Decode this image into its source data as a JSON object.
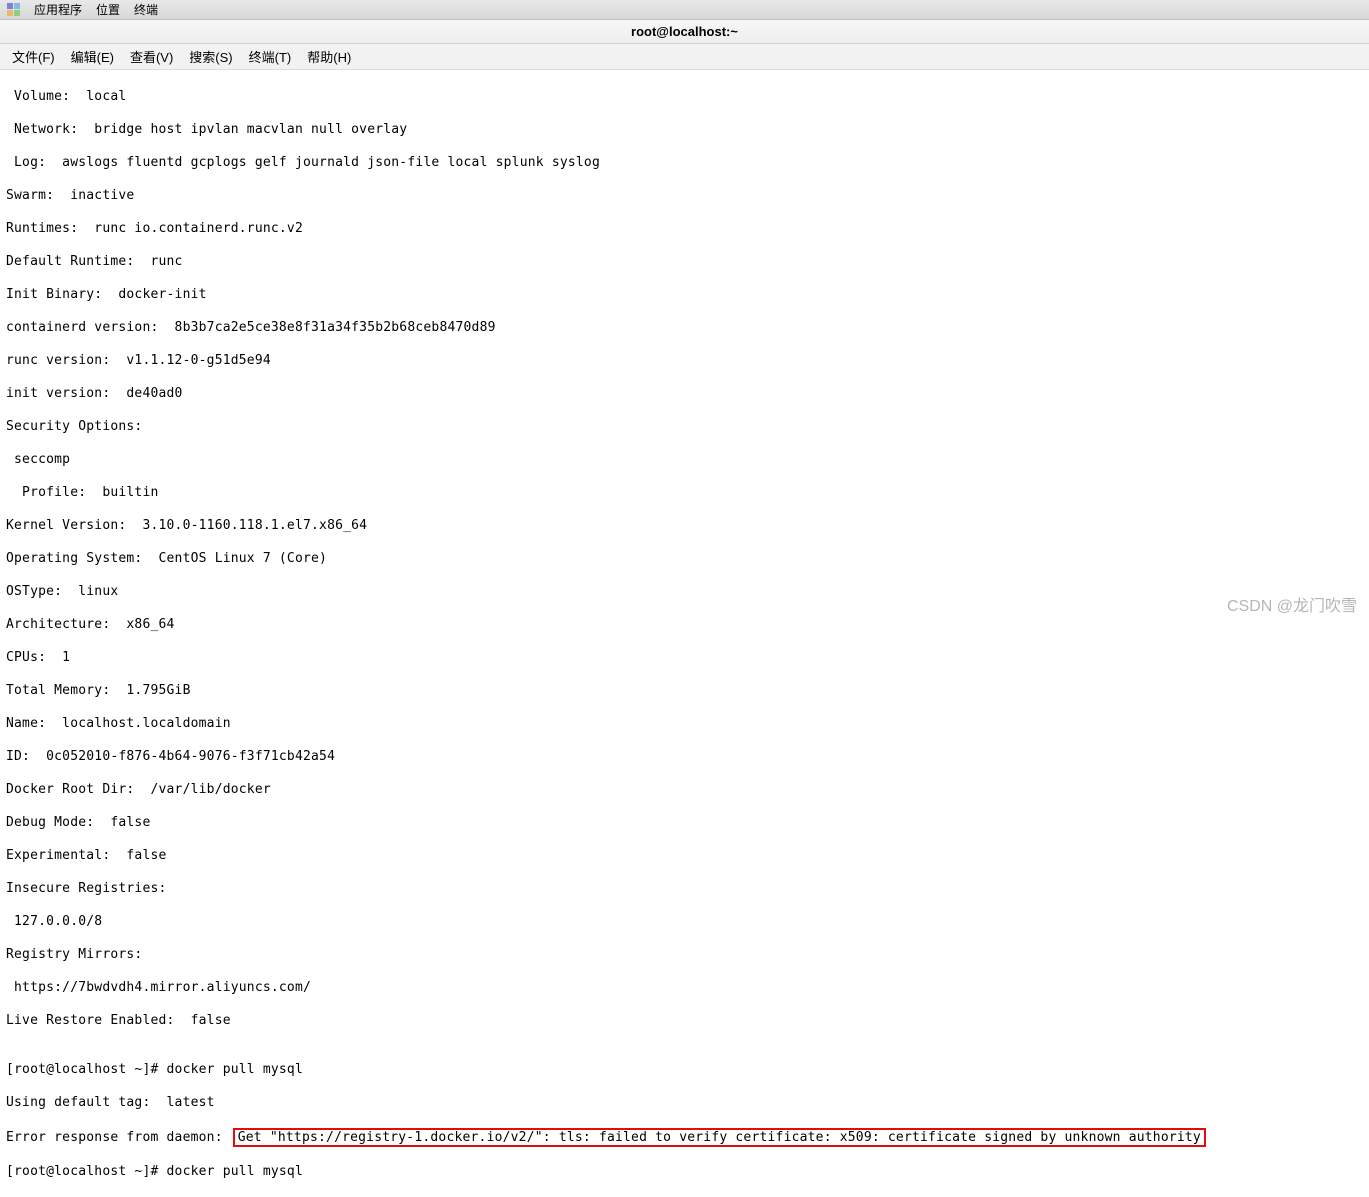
{
  "topbar": {
    "apps": "应用程序",
    "places": "位置",
    "terminal": "终端"
  },
  "titlebar": {
    "title": "root@localhost:~"
  },
  "menubar": {
    "file": "文件(F)",
    "edit": "编辑(E)",
    "view": "查看(V)",
    "search": "搜索(S)",
    "terminal": "终端(T)",
    "help": "帮助(H)"
  },
  "term": {
    "l00": " Volume:  local",
    "l01": " Network:  bridge host ipvlan macvlan null overlay",
    "l02": " Log:  awslogs fluentd gcplogs gelf journald json-file local splunk syslog",
    "l03": "Swarm:  inactive",
    "l04": "Runtimes:  runc io.containerd.runc.v2",
    "l05": "Default Runtime:  runc",
    "l06": "Init Binary:  docker-init",
    "l07": "containerd version:  8b3b7ca2e5ce38e8f31a34f35b2b68ceb8470d89",
    "l08": "runc version:  v1.1.12-0-g51d5e94",
    "l09": "init version:  de40ad0",
    "l10": "Security Options:",
    "l11": " seccomp",
    "l12": "  Profile:  builtin",
    "l13": "Kernel Version:  3.10.0-1160.118.1.el7.x86_64",
    "l14": "Operating System:  CentOS Linux 7 (Core)",
    "l15": "OSType:  linux",
    "l16": "Architecture:  x86_64",
    "l17": "CPUs:  1",
    "l18": "Total Memory:  1.795GiB",
    "l19": "Name:  localhost.localdomain",
    "l20": "ID:  0c052010-f876-4b64-9076-f3f71cb42a54",
    "l21": "Docker Root Dir:  /var/lib/docker",
    "l22": "Debug Mode:  false",
    "l23": "Experimental:  false",
    "l24": "Insecure Registries:",
    "l25": " 127.0.0.0/8",
    "l26": "Registry Mirrors:",
    "l27": " https://7bwdvdh4.mirror.aliyuncs.com/",
    "l28": "Live Restore Enabled:  false",
    "l29": "",
    "l30": "[root@localhost ~]# docker pull mysql",
    "l31": "Using default tag:  latest",
    "err_prefix": "Error response from daemon: ",
    "err_msg": "Get \"https://registry-1.docker.io/v2/\": tls: failed to verify certificate: x509: certificate signed by unknown authority",
    "l33": "[root@localhost ~]# docker pull mysql"
  },
  "watermark": "CSDN @龙门吹雪"
}
